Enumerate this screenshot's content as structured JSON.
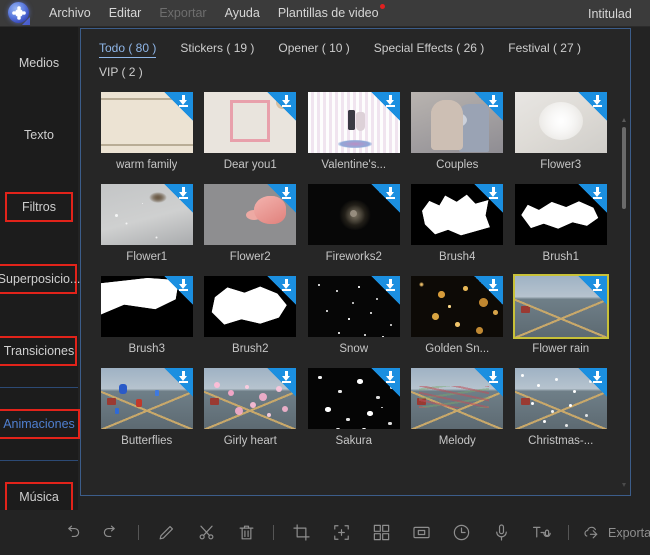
{
  "window": {
    "title": "Intitulad",
    "logo_icon": "film-reel-logo-icon"
  },
  "menubar": {
    "items": [
      {
        "label": "Archivo",
        "disabled": false,
        "badge": false
      },
      {
        "label": "Editar",
        "disabled": false,
        "badge": false
      },
      {
        "label": "Exportar",
        "disabled": true,
        "badge": false
      },
      {
        "label": "Ayuda",
        "disabled": false,
        "badge": false
      },
      {
        "label": "Plantillas de video",
        "disabled": false,
        "badge": true
      }
    ]
  },
  "sidebar": {
    "groups": [
      {
        "items": [
          {
            "label": "Medios",
            "boxed": false,
            "highlight": false
          },
          {
            "label": "Texto",
            "boxed": false,
            "highlight": false
          },
          {
            "label": "Filtros",
            "boxed": true,
            "highlight": false
          },
          {
            "label": "Superposicio...",
            "boxed": true,
            "highlight": false
          },
          {
            "label": "Transiciones",
            "boxed": true,
            "highlight": false
          }
        ]
      },
      {
        "items": [
          {
            "label": "Animaciones",
            "boxed": true,
            "highlight": true
          }
        ]
      },
      {
        "items": [
          {
            "label": "Música",
            "boxed": true,
            "highlight": false
          }
        ]
      }
    ],
    "annotation_box_color": "#e2231a",
    "separator_color": "#2c4a75"
  },
  "panel": {
    "border_color": "#3c5d8a",
    "tabs": [
      {
        "label": "Todo ( 80 )",
        "active": true
      },
      {
        "label": "Stickers ( 19 )",
        "active": false
      },
      {
        "label": "Opener ( 10 )",
        "active": false
      },
      {
        "label": "Special Effects ( 26 )",
        "active": false
      },
      {
        "label": "Festival ( 27 )",
        "active": false
      },
      {
        "label": "VIP ( 2 )",
        "active": false
      }
    ],
    "active_tab_color": "#8fb6e8",
    "selection_color": "#c8c138",
    "download_badge_color": "#1b8fe0",
    "badge_icon": "download-arrow-icon",
    "items": [
      {
        "label": "warm family",
        "art": "art-warm",
        "selected": false,
        "downloadable": true
      },
      {
        "label": "Dear you1",
        "art": "art-dear",
        "selected": false,
        "downloadable": true
      },
      {
        "label": "Valentine's...",
        "art": "art-valen",
        "selected": false,
        "downloadable": true
      },
      {
        "label": "Couples",
        "art": "art-couples",
        "selected": false,
        "downloadable": true
      },
      {
        "label": "Flower3",
        "art": "art-flower3",
        "selected": false,
        "downloadable": true
      },
      {
        "label": "Flower1",
        "art": "art-flower1",
        "selected": false,
        "downloadable": true
      },
      {
        "label": "Flower2",
        "art": "art-flower2",
        "selected": false,
        "downloadable": true
      },
      {
        "label": "Fireworks2",
        "art": "art-fw2",
        "selected": false,
        "downloadable": true
      },
      {
        "label": "Brush4",
        "art": "art-brush4",
        "selected": false,
        "downloadable": true
      },
      {
        "label": "Brush1",
        "art": "art-brush1",
        "selected": false,
        "downloadable": true
      },
      {
        "label": "Brush3",
        "art": "art-brush3",
        "selected": false,
        "downloadable": true
      },
      {
        "label": "Brush2",
        "art": "art-brush2",
        "selected": false,
        "downloadable": true
      },
      {
        "label": "Snow",
        "art": "art-snow",
        "selected": false,
        "downloadable": true
      },
      {
        "label": "Golden Sn...",
        "art": "art-golden",
        "selected": false,
        "downloadable": true
      },
      {
        "label": "Flower rain",
        "art": "art-road",
        "selected": true,
        "downloadable": true
      },
      {
        "label": "Butterflies",
        "art": "art-road art-butter",
        "selected": false,
        "downloadable": true
      },
      {
        "label": "Girly heart",
        "art": "art-road art-girly",
        "selected": false,
        "downloadable": true
      },
      {
        "label": "Sakura",
        "art": "art-sakura",
        "selected": false,
        "downloadable": true
      },
      {
        "label": "Melody",
        "art": "art-road art-melody",
        "selected": false,
        "downloadable": true
      },
      {
        "label": "Christmas-...",
        "art": "art-road art-xmas",
        "selected": false,
        "downloadable": true
      }
    ]
  },
  "toolbar": {
    "buttons": [
      {
        "icon": "undo-icon",
        "type": "icon"
      },
      {
        "icon": "redo-icon",
        "type": "icon"
      },
      {
        "icon": "separator",
        "type": "sep"
      },
      {
        "icon": "pencil-icon",
        "type": "icon"
      },
      {
        "icon": "scissors-icon",
        "type": "icon"
      },
      {
        "icon": "trash-icon",
        "type": "icon"
      },
      {
        "icon": "separator",
        "type": "sep"
      },
      {
        "icon": "crop-icon",
        "type": "icon"
      },
      {
        "icon": "add-effect-icon",
        "type": "icon"
      },
      {
        "icon": "split-screen-icon",
        "type": "icon"
      },
      {
        "icon": "picture-in-picture-icon",
        "type": "icon"
      },
      {
        "icon": "speed-clock-icon",
        "type": "icon"
      },
      {
        "icon": "microphone-icon",
        "type": "icon"
      },
      {
        "icon": "text-to-speech-icon",
        "type": "icon"
      },
      {
        "icon": "separator",
        "type": "sep"
      }
    ],
    "export_label": "Exportar",
    "export_icon": "export-upload-icon"
  }
}
